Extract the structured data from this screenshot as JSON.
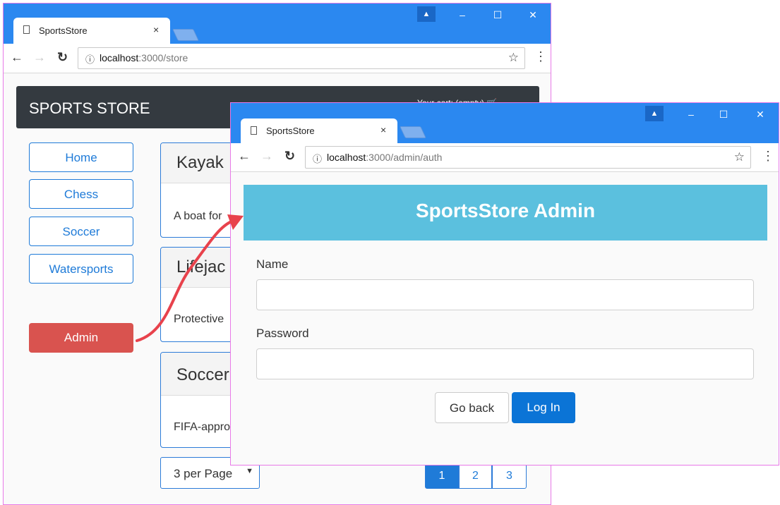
{
  "store_window": {
    "tab_title": "SportsStore",
    "tab_close": "×",
    "url_host": "localhost",
    "url_path": ":3000/store",
    "brand": "SPORTS STORE",
    "cart_label": "Your cart: (empty)",
    "categories": [
      "Home",
      "Chess",
      "Soccer",
      "Watersports"
    ],
    "admin_button": "Admin",
    "products": [
      {
        "name": "Kayak",
        "description": "A boat for"
      },
      {
        "name": "Lifejac",
        "description": "Protective"
      },
      {
        "name": "Soccer",
        "description": "FIFA-appro"
      }
    ],
    "per_page": "3 per Page",
    "pages": [
      "1",
      "2",
      "3"
    ],
    "current_page": "1"
  },
  "admin_window": {
    "tab_title": "SportsStore",
    "tab_close": "×",
    "url_host": "localhost",
    "url_path": ":3000/admin/auth",
    "header": "SportsStore Admin",
    "name_label": "Name",
    "name_value": "",
    "password_label": "Password",
    "password_value": "",
    "back_button": "Go back",
    "login_button": "Log In"
  },
  "window_controls": {
    "minimize": "–",
    "maximize": "☐",
    "close": "✕"
  },
  "icons": {
    "back": "arrow-left-icon",
    "forward": "arrow-right-icon",
    "reload": "reload-icon",
    "info": "info-icon",
    "star": "star-icon",
    "menu": "kebab-menu-icon",
    "cart": "cart-icon",
    "profile": "profile-icon",
    "page": "page-icon",
    "arrow": "annotation-arrow"
  },
  "colors": {
    "titlebar": "#2b88f0",
    "navbar": "#343a40",
    "primary": "#1f7bd8",
    "danger": "#d9534f",
    "admin_header": "#5bc0de",
    "arrow": "#e8424c"
  }
}
